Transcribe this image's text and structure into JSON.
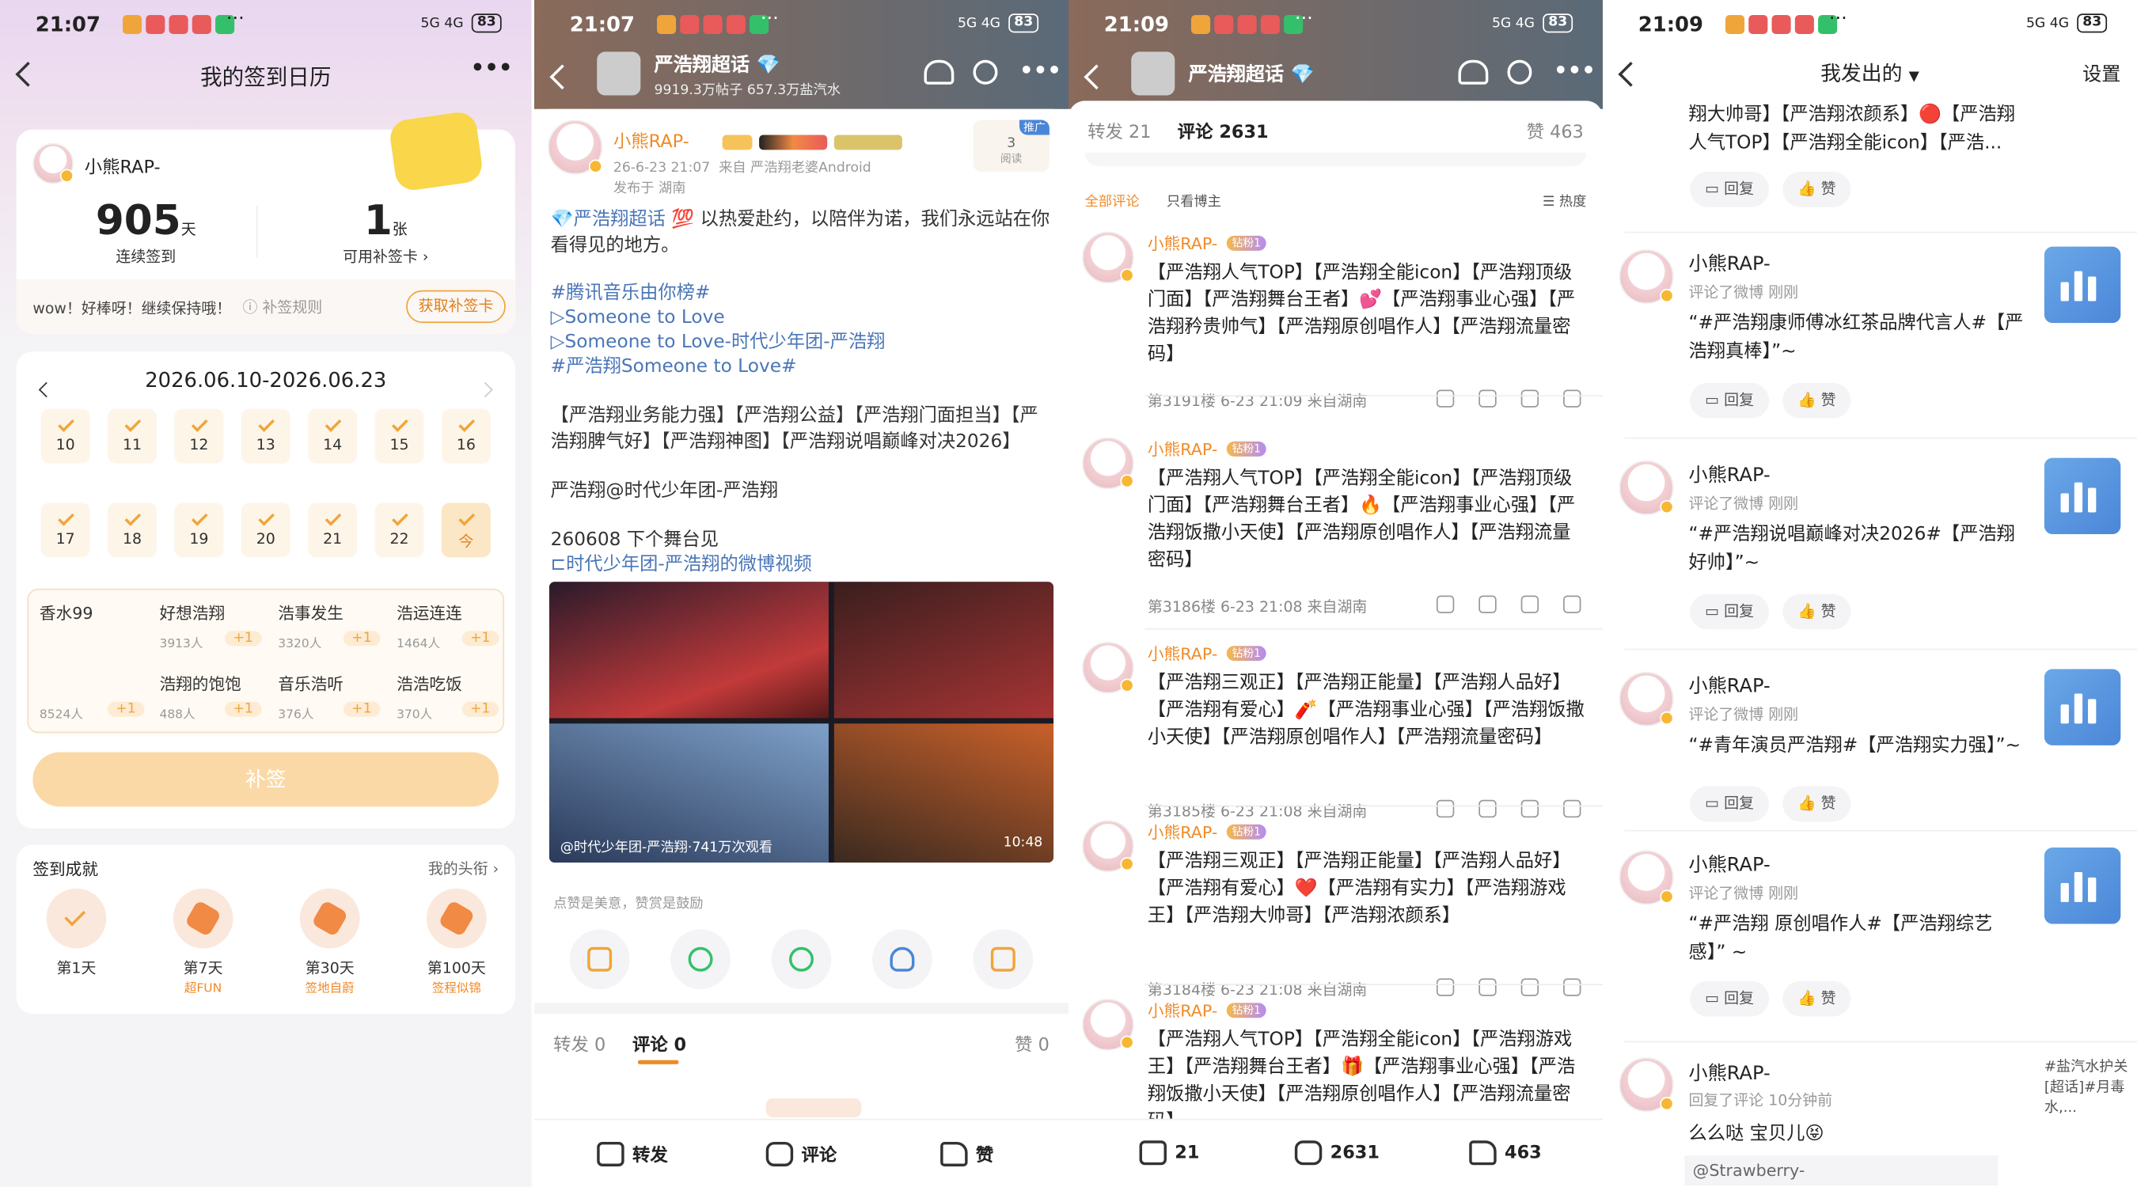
{
  "colors": {
    "accent_orange": "#f0a53a",
    "weibo_orange": "#f08a26",
    "link_blue": "#4a76b8",
    "purple_badge": "#b48cf6"
  },
  "statusbar": {
    "time1": "21:07",
    "time2": "21:07",
    "time3": "21:09",
    "time4": "21:09",
    "battery": "83",
    "dots": "···",
    "net": "5G 4G"
  },
  "checkin": {
    "title": "我的签到日历",
    "more": "•••",
    "username": "小熊RAP-",
    "streak_value": "905",
    "streak_unit": "天",
    "streak_label": "连续签到",
    "cards_value": "1",
    "cards_unit": "张",
    "cards_label": "可用补签卡",
    "encourage": "wow！好棒呀！继续保持哦！",
    "rules": "补签规则",
    "get_card": "获取补签卡",
    "date_range": "2026.06.10-2026.06.23",
    "days_row1": [
      "10",
      "11",
      "12",
      "13",
      "14",
      "15",
      "16"
    ],
    "days_row2": [
      "17",
      "18",
      "19",
      "20",
      "21",
      "22",
      "今"
    ],
    "first_task": {
      "label": "香水99",
      "count": "8524人",
      "plus": "+1"
    },
    "tasks": [
      {
        "label": "好想浩翔",
        "count": "3913人",
        "plus": "+1"
      },
      {
        "label": "浩事发生",
        "count": "3320人",
        "plus": "+1"
      },
      {
        "label": "浩运连连",
        "count": "1464人",
        "plus": "+1"
      },
      {
        "label": "浩翔的饱饱",
        "count": "488人",
        "plus": "+1"
      },
      {
        "label": "音乐浩听",
        "count": "376人",
        "plus": "+1"
      },
      {
        "label": "浩浩吃饭",
        "count": "370人",
        "plus": "+1"
      }
    ],
    "makeup_button": "补签",
    "achievements_title": "签到成就",
    "my_title_link": "我的头衔",
    "achievements": [
      {
        "day": "第1天",
        "title": ""
      },
      {
        "day": "第7天",
        "title": "超FUN"
      },
      {
        "day": "第30天",
        "title": "签地自蔚"
      },
      {
        "day": "第100天",
        "title": "签程似锦"
      }
    ]
  },
  "post": {
    "group": "严浩翔超话",
    "group_stats": "9919.3万帖子 657.3万盐汽水",
    "author": "小熊RAP-",
    "date": "26-6-23 21:07",
    "from": "来自 严浩翔老婆Android",
    "location": "发布于 湖南",
    "promo": "推广",
    "reads_count": "3",
    "reads_label": "阅读",
    "line1_topic": "严浩翔超话",
    "line1_rest": "💯 以热爱赴约，以陪伴为诺，我们永远站在你看得见的地方。",
    "tag1": "#腾讯音乐由你榜#",
    "song1": "▷Someone to Love",
    "song2": "▷Someone to Love-时代少年团-严浩翔",
    "tag2": "#严浩翔Someone to Love#",
    "body2": "【严浩翔业务能力强】【严浩翔公益】【严浩翔门面担当】【严浩翔脾气好】【严浩翔神图】【严浩翔说唱巅峰对决2026】",
    "body3": "严浩翔@时代少年团-严浩翔",
    "body4": "260608 下个舞台见",
    "video_link": "时代少年团-严浩翔的微博视频",
    "video_caption": "@时代少年团-严浩翔·741万次观看",
    "video_duration": "10:48",
    "like_hint": "点赞是美意，赞赏是鼓励",
    "tab_repost": "转发 0",
    "tab_comment": "评论 0",
    "tab_like": "赞 0",
    "bottom_repost": "转发",
    "bottom_comment": "评论",
    "bottom_like": "赞"
  },
  "comments": {
    "group": "严浩翔超话",
    "tab_repost": "转发 21",
    "tab_comment": "评论 2631",
    "tab_like": "赞 463",
    "filter_all": "全部评论",
    "filter_host": "只看博主",
    "sort": "热度",
    "level": "钻粉1",
    "list": [
      {
        "name": "小熊RAP-",
        "body": "【严浩翔人气TOP】【严浩翔全能icon】【严浩翔顶级门面】【严浩翔舞台王者】💕【严浩翔事业心强】【严浩翔矜贵帅气】【严浩翔原创唱作人】【严浩翔流量密码】",
        "meta": "第3191楼 6-23 21:09 来自湖南"
      },
      {
        "name": "小熊RAP-",
        "body": "【严浩翔人气TOP】【严浩翔全能icon】【严浩翔顶级门面】【严浩翔舞台王者】🔥【严浩翔事业心强】【严浩翔饭撒小天使】【严浩翔原创唱作人】【严浩翔流量密码】",
        "meta": "第3186楼 6-23 21:08 来自湖南"
      },
      {
        "name": "小熊RAP-",
        "body": "【严浩翔三观正】【严浩翔正能量】【严浩翔人品好】【严浩翔有爱心】🧨【严浩翔事业心强】【严浩翔饭撒小天使】【严浩翔原创唱作人】【严浩翔流量密码】",
        "meta": "第3185楼 6-23 21:08 来自湖南"
      },
      {
        "name": "小熊RAP-",
        "body": "【严浩翔三观正】【严浩翔正能量】【严浩翔人品好】【严浩翔有爱心】❤️【严浩翔有实力】【严浩翔游戏王】【严浩翔大帅哥】【严浩翔浓颜系】",
        "meta": "第3184楼 6-23 21:08 来自湖南"
      },
      {
        "name": "小熊RAP-",
        "body": "【严浩翔人气TOP】【严浩翔全能icon】【严浩翔游戏王】【严浩翔舞台王者】🎁【严浩翔事业心强】【严浩翔饭撒小天使】【严浩翔原创唱作人】【严浩翔流量密码】",
        "meta": ""
      }
    ],
    "bottom_repost": "21",
    "bottom_comment": "2631",
    "bottom_like": "463"
  },
  "sent": {
    "title": "我发出的",
    "settings": "设置",
    "top_text": "翔大帅哥】【严浩翔浓颜系】🔴【严浩翔人气TOP】【严浩翔全能icon】【严浩...",
    "reply": "回复",
    "like": "赞",
    "items": [
      {
        "name": "小熊RAP-",
        "sub": "评论了微博  刚刚",
        "txt": "“#严浩翔康师傅冰红茶品牌代言人#【严浩翔真棒】”~"
      },
      {
        "name": "小熊RAP-",
        "sub": "评论了微博  刚刚",
        "txt": "“#严浩翔说唱巅峰对决2026#【严浩翔好帅】”~"
      },
      {
        "name": "小熊RAP-",
        "sub": "评论了微博  刚刚",
        "txt": "“#青年演员严浩翔#【严浩翔实力强】”~"
      },
      {
        "name": "小熊RAP-",
        "sub": "评论了微博  刚刚",
        "txt": "“#严浩翔 原创唱作人#【严浩翔综艺感】” ~"
      }
    ],
    "last": {
      "name": "小熊RAP-",
      "sub": "回复了评论  10分钟前",
      "txt": "么么哒 宝贝儿😝",
      "quote": "@Strawberry-",
      "side": "#盐汽水护关[超话]#月毒水,..."
    }
  }
}
